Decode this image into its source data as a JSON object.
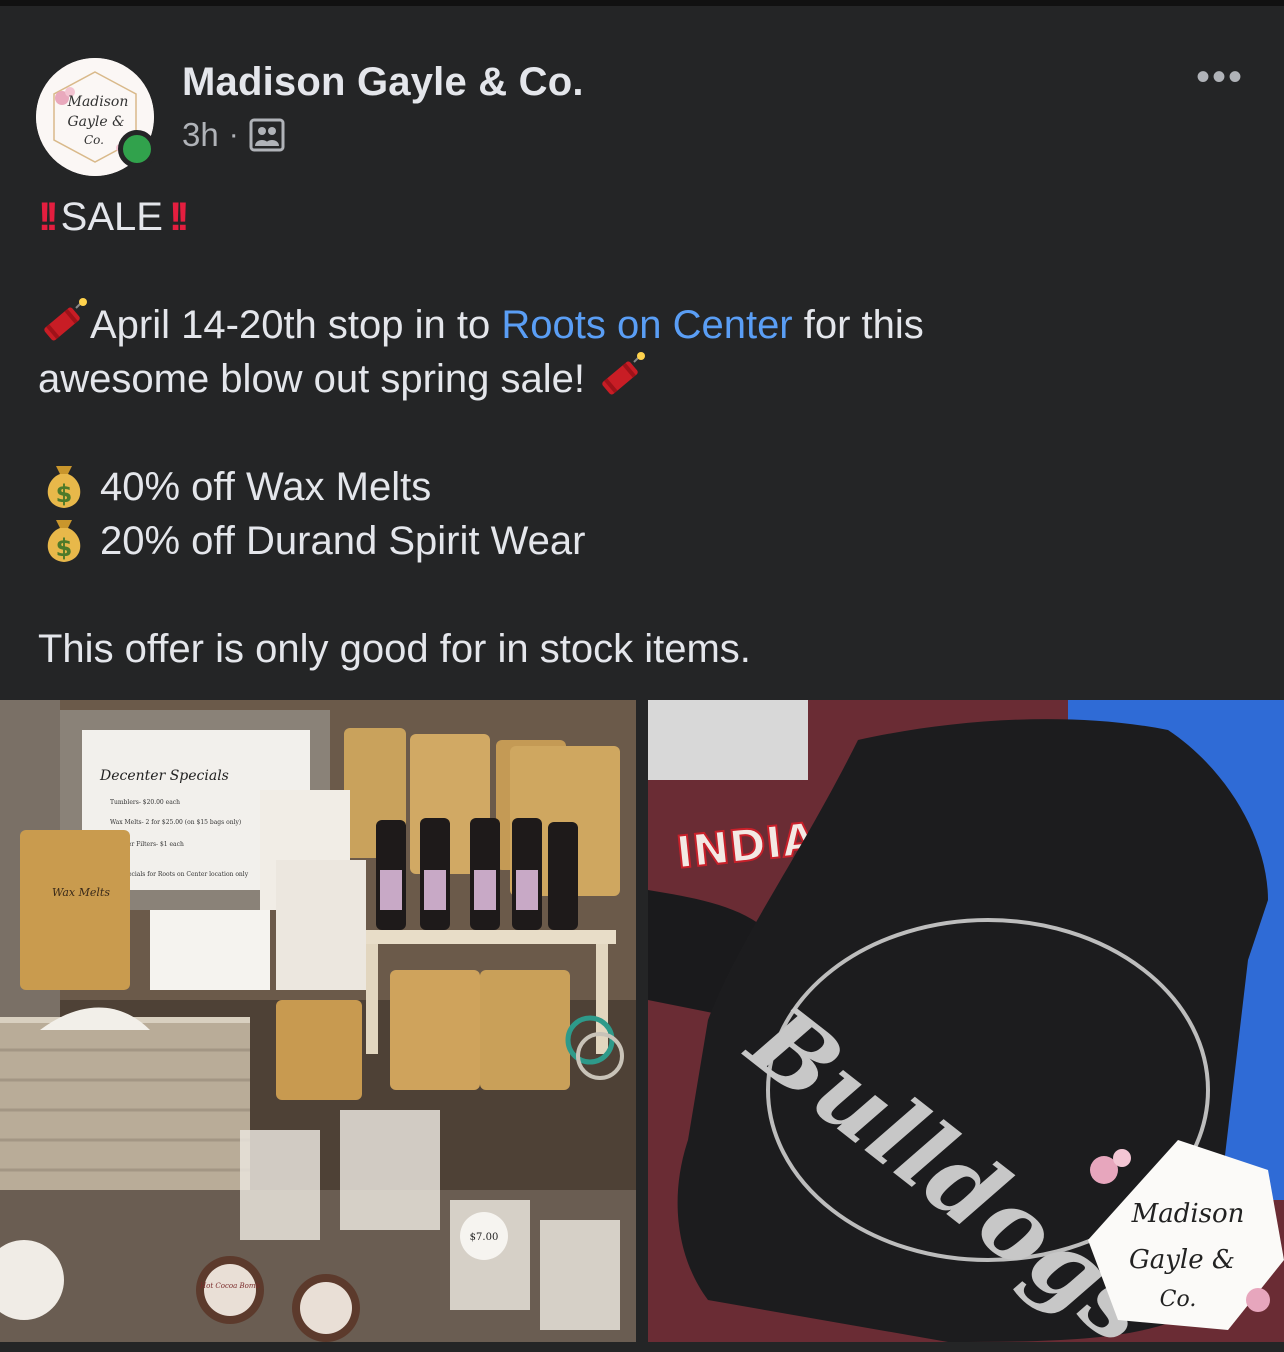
{
  "post": {
    "author": "Madison Gayle & Co.",
    "time": "3h",
    "separator": "·",
    "more_label": "•••",
    "heading": "SALE",
    "line1_pre": "April 14-20th stop in to ",
    "line1_link": "Roots on Center",
    "line1_post": " for this",
    "line2": "awesome blow out spring sale!",
    "offer1": "40% off Wax Melts",
    "offer2": "20% off Durand Spirit Wear",
    "disclaimer": "This offer is only good for in stock items."
  },
  "avatar": {
    "logo_text_line1": "Madison",
    "logo_text_line2": "Gayle &",
    "logo_text_line3": "Co."
  },
  "photo_left": {
    "sign_title": "Decenter Specials",
    "sign_line1": "Tumblers- $20.00 each",
    "sign_line2": "Wax Melts- 2 for $25.00 (on $15 bags only)",
    "sign_line3": "Warmer Filters- $1 each",
    "sign_line4": "Specials for Roots on Center location only",
    "bag_label": "Wax Melts",
    "tin_label1": "Hot Cocoa Bomb",
    "price_tag": "$7.00"
  },
  "photo_right": {
    "shirt_text1": "INDIANS",
    "shirt_text2": "Bulldogs",
    "watermark_line1": "Madison",
    "watermark_line2": "Gayle &",
    "watermark_line3": "Co."
  },
  "colors": {
    "background": "#242526",
    "link": "#5a9ef5",
    "online": "#31a24c",
    "alert": "#e41e3f"
  },
  "icons": [
    "more-options-icon",
    "audience-icon",
    "double-exclamation-icon",
    "firecracker-icon",
    "money-bag-icon"
  ]
}
